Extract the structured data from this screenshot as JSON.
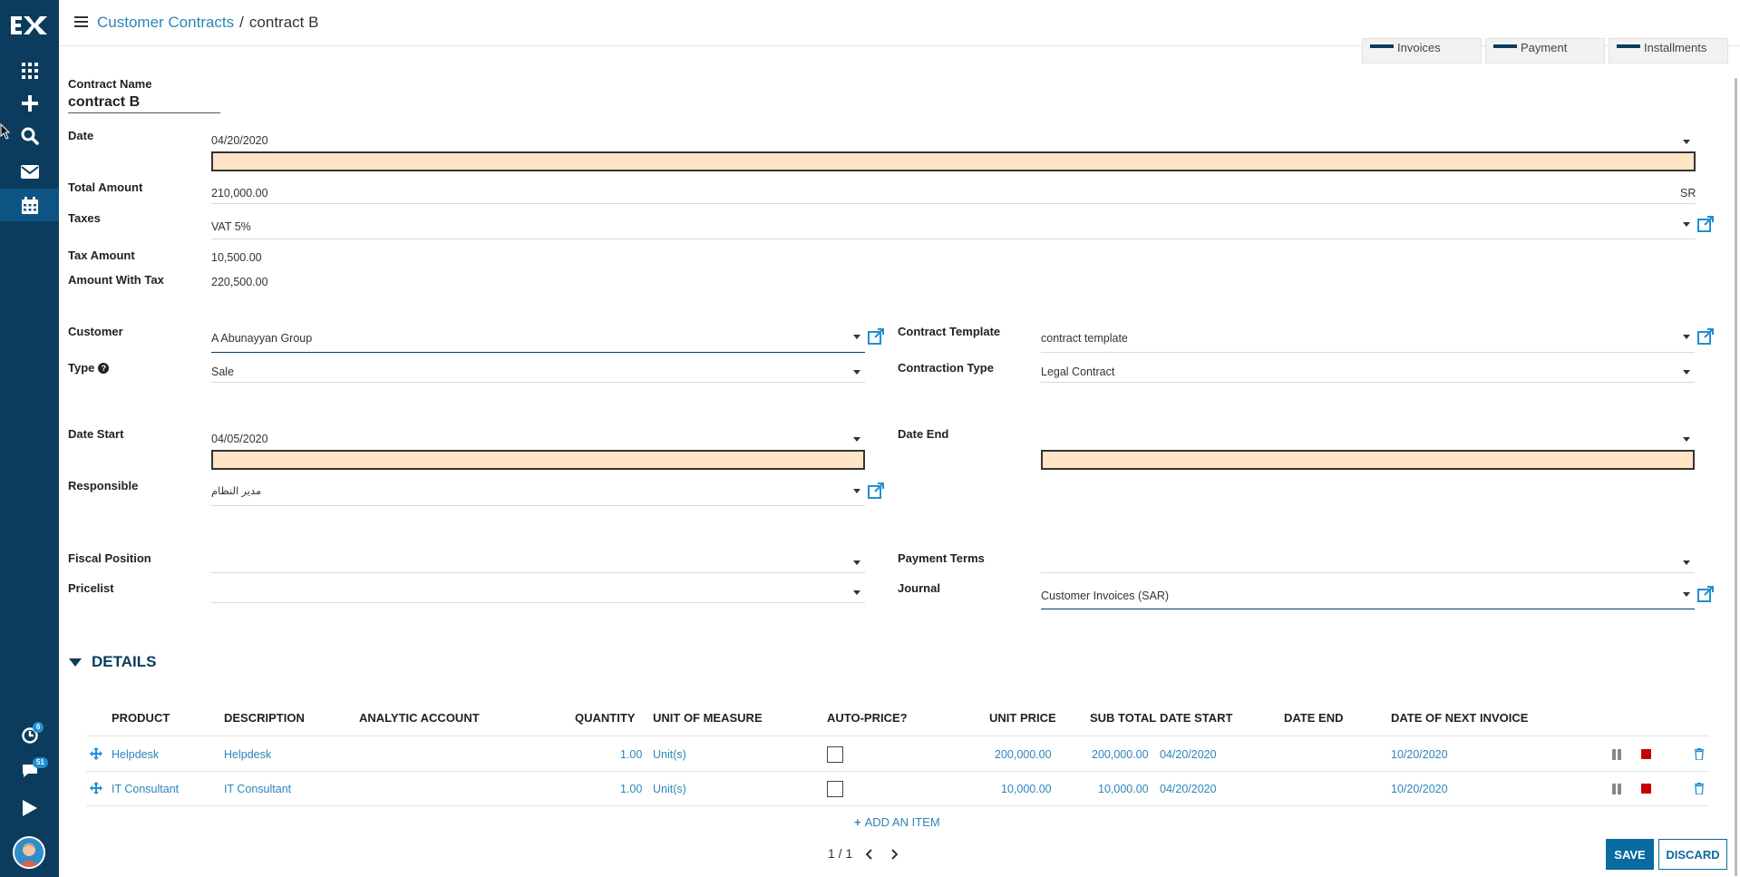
{
  "header": {
    "breadcrumb_parent": "Customer Contracts",
    "breadcrumb_sep": "/",
    "breadcrumb_current": "contract B"
  },
  "smart_buttons": [
    "Invoices",
    "Payment",
    "Installments"
  ],
  "sidebar": {
    "icons": [
      "apps-icon",
      "plus-icon",
      "search-icon",
      "mail-icon",
      "calendar-icon"
    ],
    "badge_activity": "6",
    "badge_chat": "51"
  },
  "form": {
    "contract_name_label": "Contract Name",
    "contract_name": "contract B",
    "date_label": "Date",
    "date": "04/20/2020",
    "total_amount_label": "Total Amount",
    "total_amount": "210,000.00",
    "currency": "SR",
    "taxes_label": "Taxes",
    "taxes": "VAT 5%",
    "tax_amount_label": "Tax Amount",
    "tax_amount": "10,500.00",
    "amount_with_tax_label": "Amount With Tax",
    "amount_with_tax": "220,500.00",
    "customer_label": "Customer",
    "customer": "A Abunayyan Group",
    "type_label": "Type",
    "type_help": "?",
    "type": "Sale",
    "contract_template_label": "Contract Template",
    "contract_template": "contract template",
    "contraction_type_label": "Contraction Type",
    "contraction_type": "Legal Contract",
    "date_start_label": "Date Start",
    "date_start": "04/05/2020",
    "date_end_label": "Date End",
    "date_end": "",
    "responsible_label": "Responsible",
    "responsible": "مدير النظام",
    "fiscal_position_label": "Fiscal Position",
    "fiscal_position": "",
    "payment_terms_label": "Payment Terms",
    "payment_terms": "",
    "pricelist_label": "Pricelist",
    "pricelist": "",
    "journal_label": "Journal",
    "journal": "Customer Invoices (SAR)"
  },
  "details": {
    "title": "DETAILS",
    "columns": [
      "Product",
      "Description",
      "Analytic Account",
      "Quantity",
      "Unit of Measure",
      "Auto-price?",
      "Unit Price",
      "Sub Total",
      "Date Start",
      "Date End",
      "Date of Next Invoice"
    ],
    "rows": [
      {
        "product": "Helpdesk",
        "description": "Helpdesk",
        "analytic": "",
        "quantity": "1.00",
        "uom": "Unit(s)",
        "unit_price": "200,000.00",
        "sub_total": "200,000.00",
        "date_start": "04/20/2020",
        "date_end": "",
        "next_invoice": "10/20/2020"
      },
      {
        "product": "IT Consultant",
        "description": "IT Consultant",
        "analytic": "",
        "quantity": "1.00",
        "uom": "Unit(s)",
        "unit_price": "10,000.00",
        "sub_total": "10,000.00",
        "date_start": "04/20/2020",
        "date_end": "",
        "next_invoice": "10/20/2020"
      }
    ],
    "add_item": "ADD AN ITEM"
  },
  "footer": {
    "pager": "1 / 1",
    "save": "SAVE",
    "discard": "DISCARD"
  }
}
